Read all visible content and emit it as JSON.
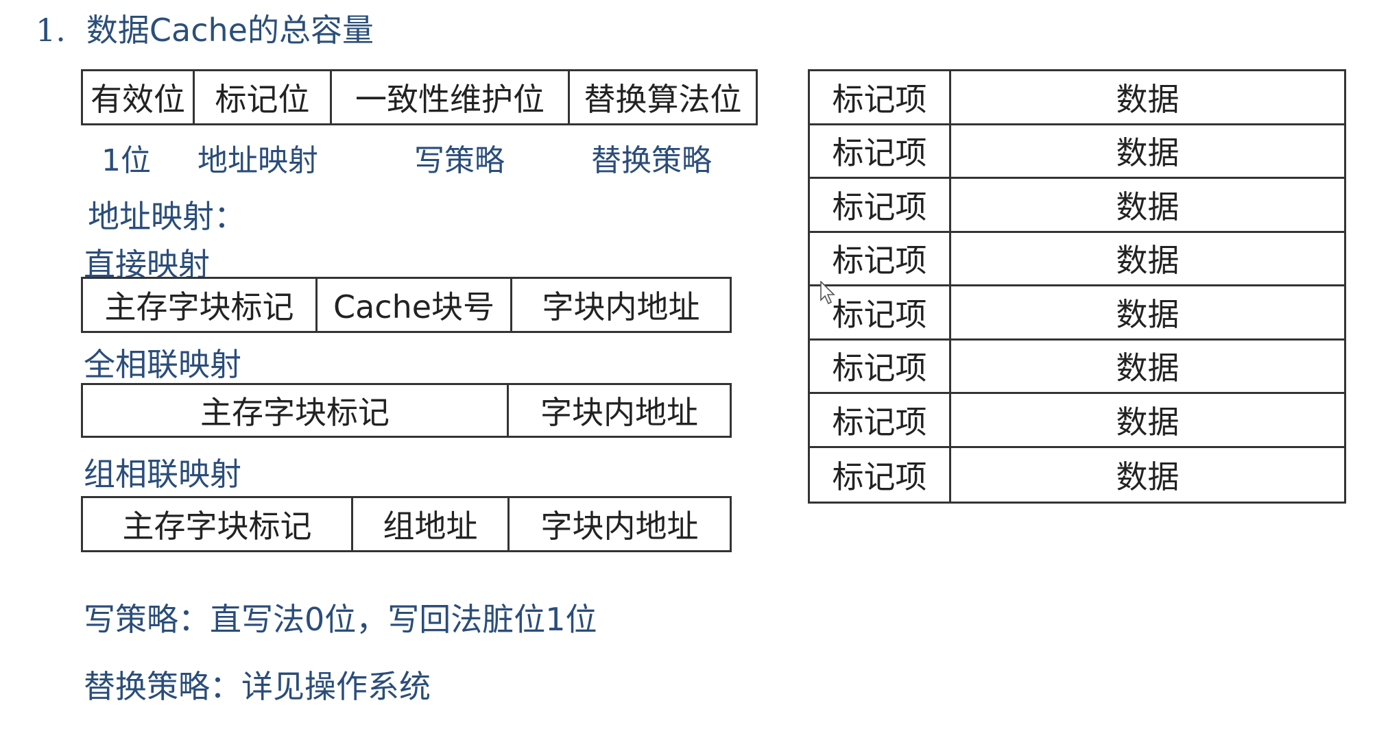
{
  "title": {
    "number": "1.",
    "text": "数据Cache的总容量"
  },
  "cache_line": {
    "fields": [
      "有效位",
      "标记位",
      "一致性维护位",
      "替换算法位"
    ],
    "notes": [
      "1位",
      "地址映射",
      "写策略",
      "替换策略"
    ]
  },
  "address_mapping_label": "地址映射：",
  "direct": {
    "label": "直接映射",
    "fields": [
      "主存字块标记",
      "Cache块号",
      "字块内地址"
    ]
  },
  "fully_associative": {
    "label": "全相联映射",
    "fields": [
      "主存字块标记",
      "字块内地址"
    ]
  },
  "set_associative": {
    "label": "组相联映射",
    "fields": [
      "主存字块标记",
      "组地址",
      "字块内地址"
    ]
  },
  "write_policy": "写策略：直写法0位，写回法脏位1位",
  "replacement_policy": "替换策略：详见操作系统",
  "cache_table": {
    "rows": [
      {
        "tag": "标记项",
        "data": "数据"
      },
      {
        "tag": "标记项",
        "data": "数据"
      },
      {
        "tag": "标记项",
        "data": "数据"
      },
      {
        "tag": "标记项",
        "data": "数据"
      },
      {
        "tag": "标记项",
        "data": "数据"
      },
      {
        "tag": "标记项",
        "data": "数据"
      },
      {
        "tag": "标记项",
        "data": "数据"
      },
      {
        "tag": "标记项",
        "data": "数据"
      }
    ]
  }
}
